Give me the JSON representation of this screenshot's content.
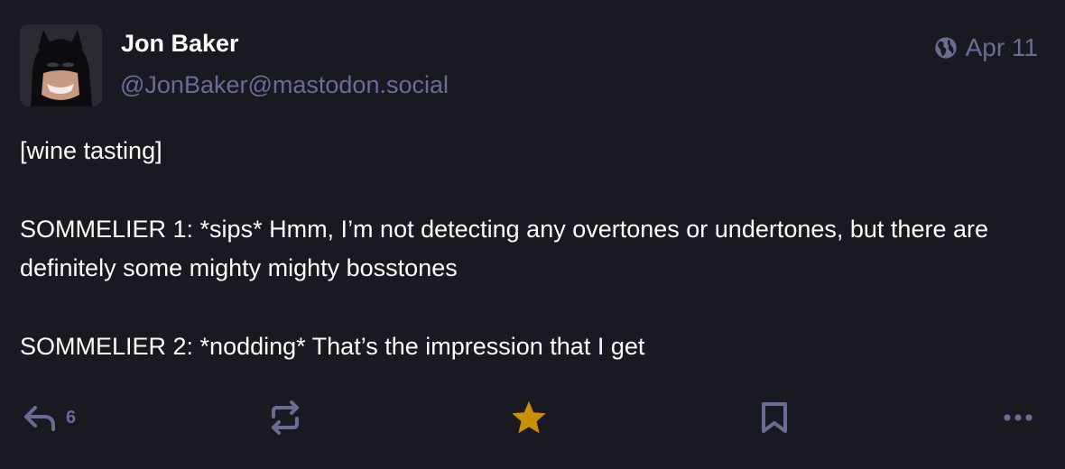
{
  "post": {
    "author": {
      "display_name": "Jon Baker",
      "handle": "@JonBaker@mastodon.social",
      "avatar": "batman-avatar"
    },
    "timestamp": "Apr 11",
    "visibility_icon": "globe-icon",
    "content": {
      "line1": "[wine tasting]",
      "para2": "SOMMELIER 1: *sips* Hmm, I’m not detecting any overtones or undertones, but there are definitely some mighty mighty bosstones",
      "para3": "SOMMELIER 2: *nodding* That’s the impression that I get"
    }
  },
  "actions": {
    "reply": {
      "icon": "reply-icon",
      "count": "6"
    },
    "boost": {
      "icon": "boost-icon"
    },
    "favourite": {
      "icon": "star-icon",
      "active": true
    },
    "bookmark": {
      "icon": "bookmark-icon"
    },
    "more": {
      "icon": "more-icon"
    }
  },
  "colors": {
    "background": "#191922",
    "text": "#ffffff",
    "secondary": "#6e6b93",
    "favourite_active": "#ca8f04"
  }
}
